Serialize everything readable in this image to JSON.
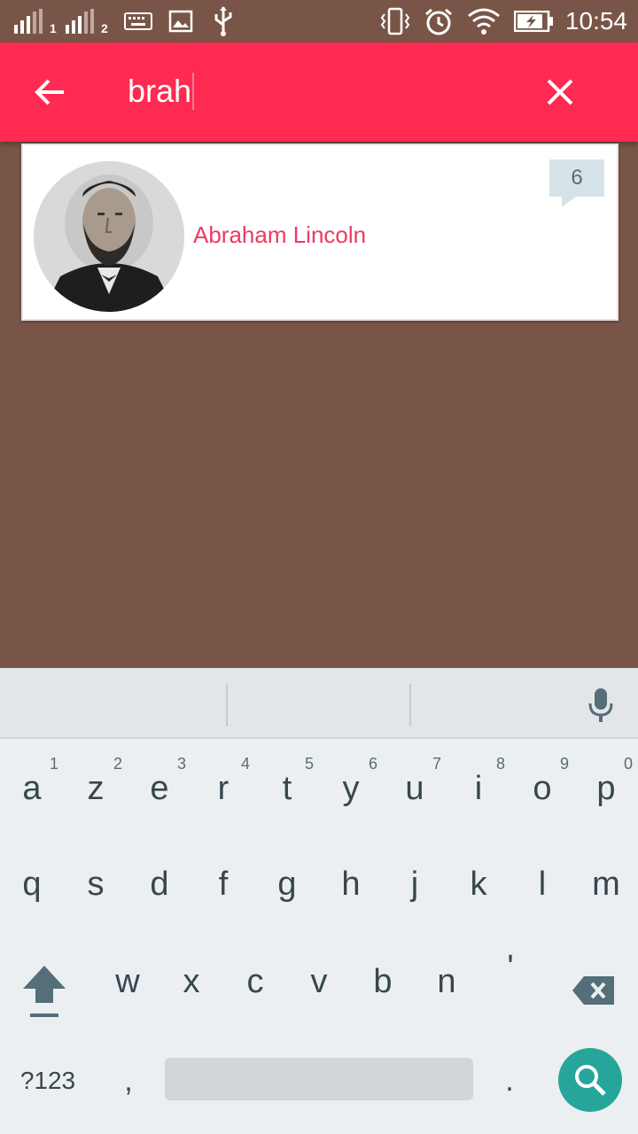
{
  "status_bar": {
    "sim1_label": "1",
    "sim2_label": "2",
    "time": "10:54",
    "icons": [
      "signal-sim1-icon",
      "signal-sim2-icon",
      "keyboard-icon",
      "image-icon",
      "usb-icon",
      "vibrate-icon",
      "alarm-icon",
      "wifi-icon",
      "battery-charging-icon"
    ]
  },
  "toolbar": {
    "back_icon": "arrow-back-icon",
    "query": "brah",
    "clear_icon": "close-icon",
    "color": "#ff2a52"
  },
  "results": [
    {
      "name": "Abraham Lincoln",
      "count": "6",
      "avatar": "portrait-photo"
    }
  ],
  "keyboard": {
    "row1": [
      {
        "key": "a",
        "hint": "1"
      },
      {
        "key": "z",
        "hint": "2"
      },
      {
        "key": "e",
        "hint": "3"
      },
      {
        "key": "r",
        "hint": "4"
      },
      {
        "key": "t",
        "hint": "5"
      },
      {
        "key": "y",
        "hint": "6"
      },
      {
        "key": "u",
        "hint": "7"
      },
      {
        "key": "i",
        "hint": "8"
      },
      {
        "key": "o",
        "hint": "9"
      },
      {
        "key": "p",
        "hint": "0"
      }
    ],
    "row2": [
      "q",
      "s",
      "d",
      "f",
      "g",
      "h",
      "j",
      "k",
      "l",
      "m"
    ],
    "row3": [
      "w",
      "x",
      "c",
      "v",
      "b",
      "n",
      "'"
    ],
    "symbols_label": "?123",
    "comma": ",",
    "period": ".",
    "accent_color": "#26a69a"
  },
  "colors": {
    "background": "#795548",
    "name_text": "#ec3b62"
  }
}
